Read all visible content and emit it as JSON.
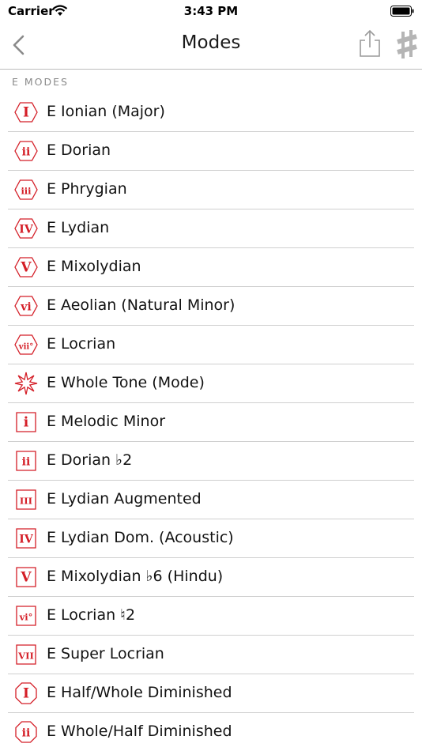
{
  "status_bar": {
    "carrier": "Carrier",
    "time": "3:43 PM"
  },
  "nav": {
    "title": "Modes"
  },
  "section": {
    "header": "E MODES"
  },
  "accent": "#d41e27",
  "modes": [
    {
      "label": "E Ionian (Major)",
      "numeral": "I",
      "shape": "hexagon"
    },
    {
      "label": "E Dorian",
      "numeral": "ii",
      "shape": "hexagon"
    },
    {
      "label": "E Phrygian",
      "numeral": "iii",
      "shape": "hexagon"
    },
    {
      "label": "E Lydian",
      "numeral": "IV",
      "shape": "hexagon"
    },
    {
      "label": "E Mixolydian",
      "numeral": "V",
      "shape": "hexagon"
    },
    {
      "label": "E Aeolian (Natural Minor)",
      "numeral": "vi",
      "shape": "hexagon"
    },
    {
      "label": "E Locrian",
      "numeral": "vii°",
      "shape": "hexagon"
    },
    {
      "label": "E Whole Tone (Mode)",
      "numeral": "",
      "shape": "star"
    },
    {
      "label": "E Melodic Minor",
      "numeral": "i",
      "shape": "square"
    },
    {
      "label": "E Dorian ♭2",
      "numeral": "ii",
      "shape": "square"
    },
    {
      "label": "E Lydian Augmented",
      "numeral": "III",
      "shape": "square"
    },
    {
      "label": "E Lydian Dom. (Acoustic)",
      "numeral": "IV",
      "shape": "square"
    },
    {
      "label": "E Mixolydian ♭6 (Hindu)",
      "numeral": "V",
      "shape": "square"
    },
    {
      "label": "E Locrian ♮2",
      "numeral": "vi°",
      "shape": "square"
    },
    {
      "label": "E Super Locrian",
      "numeral": "VII",
      "shape": "square"
    },
    {
      "label": "E Half/Whole Diminished",
      "numeral": "I",
      "shape": "octagon"
    },
    {
      "label": "E Whole/Half Diminished",
      "numeral": "ii",
      "shape": "octagon"
    }
  ]
}
